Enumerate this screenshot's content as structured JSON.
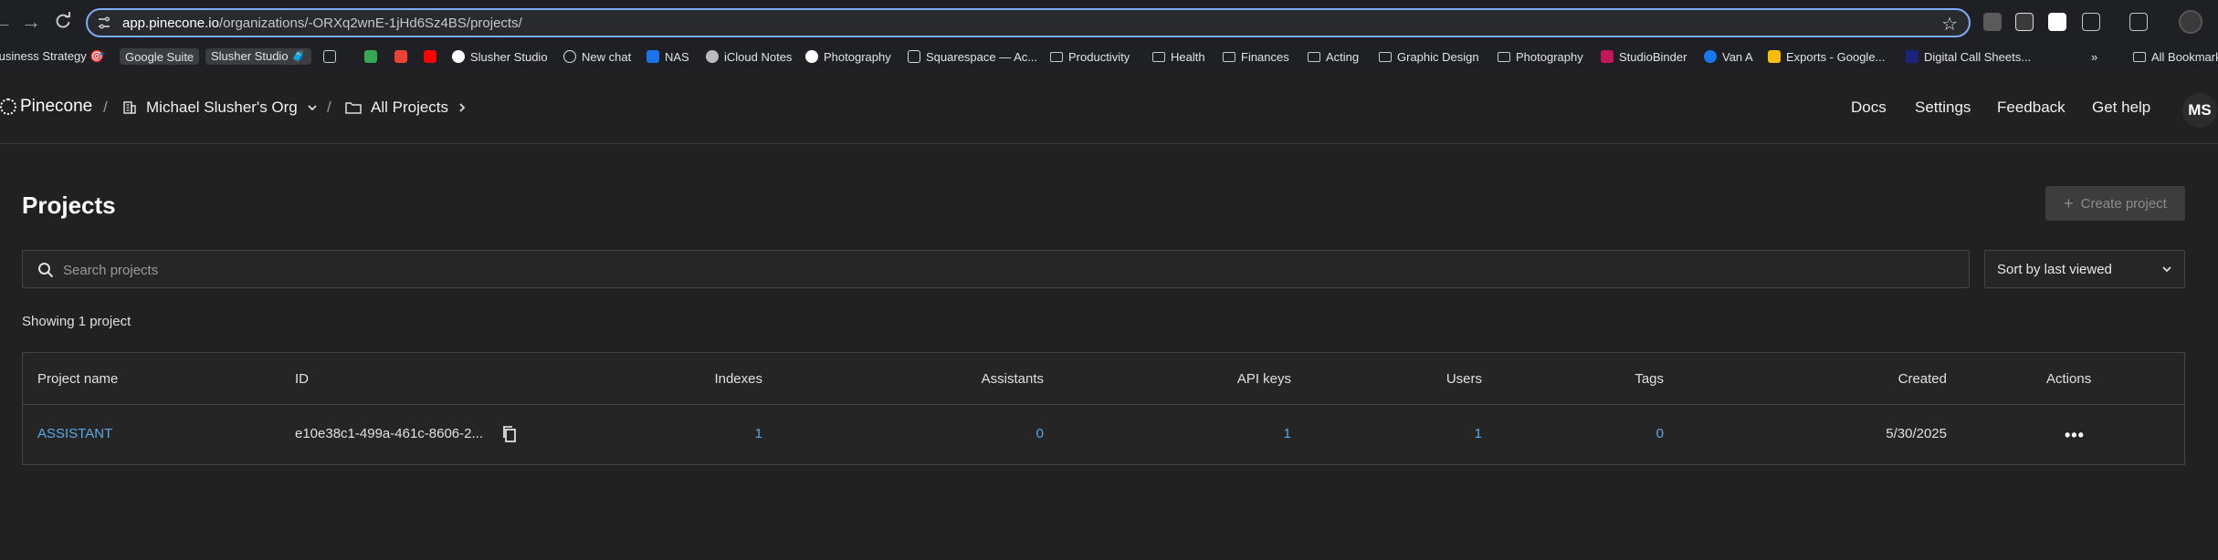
{
  "browser": {
    "url_host": "app.pinecone.io",
    "url_path": "/organizations/-ORXq2wnE-1jHd6Sz4BS/projects/",
    "bookmarks": [
      {
        "label": "Business Strategy 🎯"
      },
      {
        "label": "Google Suite"
      },
      {
        "label": "Slusher Studio 🧳"
      },
      {
        "label": "Slusher Studio"
      },
      {
        "label": "New chat"
      },
      {
        "label": "NAS"
      },
      {
        "label": "iCloud Notes"
      },
      {
        "label": "Photography"
      },
      {
        "label": "Squarespace — Ac..."
      },
      {
        "label": "Productivity"
      },
      {
        "label": "Health"
      },
      {
        "label": "Finances"
      },
      {
        "label": "Acting"
      },
      {
        "label": "Graphic Design"
      },
      {
        "label": "Photography"
      },
      {
        "label": "StudioBinder"
      },
      {
        "label": "Van A"
      },
      {
        "label": "Exports - Google..."
      },
      {
        "label": "Digital Call Sheets..."
      },
      {
        "label": "All Bookmarks"
      }
    ]
  },
  "header": {
    "brand": "Pinecone",
    "org_name": "Michael Slusher's Org",
    "projects_crumb": "All Projects",
    "links": {
      "docs": "Docs",
      "settings": "Settings",
      "feedback": "Feedback",
      "help": "Get help"
    },
    "user_initials": "MS"
  },
  "main": {
    "title": "Projects",
    "create_label": "Create project",
    "search_placeholder": "Search projects",
    "sort_value": "Sort by last viewed",
    "showing": "Showing 1 project",
    "columns": {
      "name": "Project name",
      "id": "ID",
      "indexes": "Indexes",
      "assistants": "Assistants",
      "api_keys": "API keys",
      "users": "Users",
      "tags": "Tags",
      "created": "Created",
      "actions": "Actions"
    },
    "rows": [
      {
        "name": "ASSISTANT",
        "id": "e10e38c1-499a-461c-8606-2...",
        "indexes": "1",
        "assistants": "0",
        "api_keys": "1",
        "users": "1",
        "tags": "0",
        "created": "5/30/2025"
      }
    ]
  }
}
